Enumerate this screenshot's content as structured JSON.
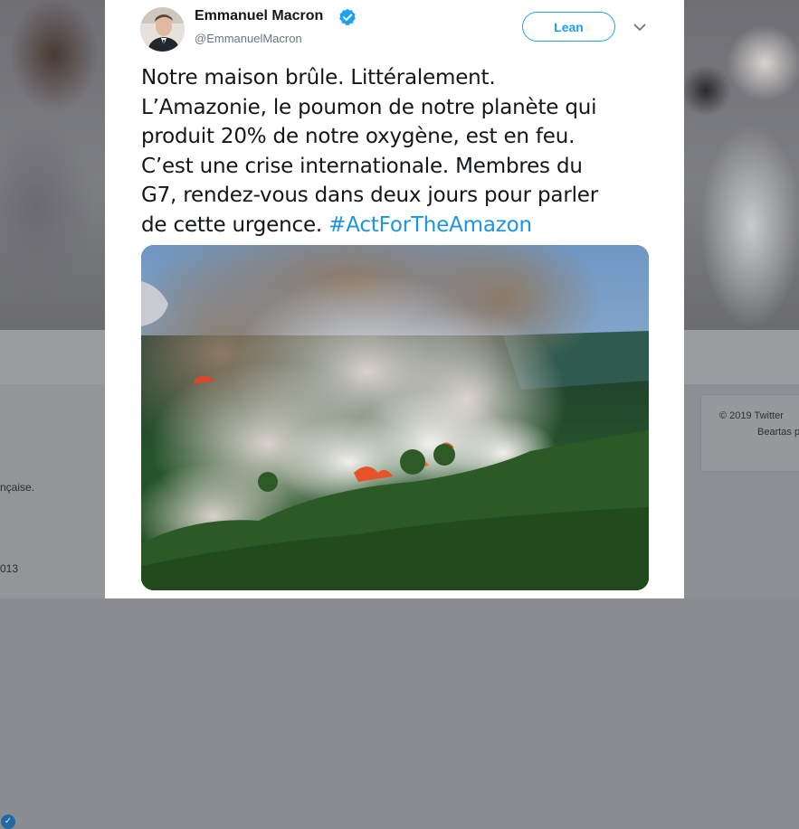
{
  "tweet": {
    "author_name": "Emmanuel Macron",
    "author_handle": "@EmmanuelMacron",
    "verified": true,
    "follow_label": "Lean",
    "text_lines": [
      "Notre maison brûle. Littéralement.",
      "L’Amazonie, le poumon de notre planète qui",
      "produit 20% de notre oxygène, est en feu.",
      "C’est une crise internationale. Membres du",
      "G7, rendez-vous dans deux jours pour parler"
    ],
    "last_line_text": "de cette urgence.",
    "hashtag": "#ActForTheAmazon",
    "media_icon": "amazon-fire-aerial-photo",
    "colors": {
      "accent": "#1da1f2",
      "hashtag": "#1b95e0",
      "text": "#14171a",
      "secondary_text": "#657786"
    }
  },
  "background": {
    "left_text_1": "nçaise.",
    "left_text_2": "013",
    "right_footer_line_1": "© 2019 Twitter",
    "right_footer_line_2": "Beartas p"
  }
}
